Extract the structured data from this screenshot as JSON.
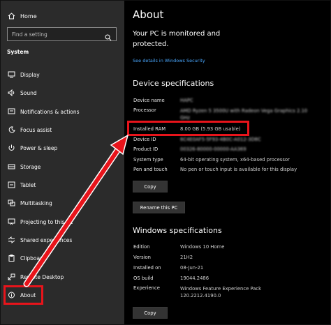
{
  "sidebar": {
    "home_label": "Home",
    "search_placeholder": "Find a setting",
    "section_label": "System",
    "items": [
      {
        "label": "Display",
        "icon": "display-icon"
      },
      {
        "label": "Sound",
        "icon": "sound-icon"
      },
      {
        "label": "Notifications & actions",
        "icon": "notifications-icon"
      },
      {
        "label": "Focus assist",
        "icon": "focus-assist-icon"
      },
      {
        "label": "Power & sleep",
        "icon": "power-icon"
      },
      {
        "label": "Storage",
        "icon": "storage-icon"
      },
      {
        "label": "Tablet",
        "icon": "tablet-icon"
      },
      {
        "label": "Multitasking",
        "icon": "multitasking-icon"
      },
      {
        "label": "Projecting to this PC",
        "icon": "projecting-icon"
      },
      {
        "label": "Shared experiences",
        "icon": "shared-experiences-icon"
      },
      {
        "label": "Clipboard",
        "icon": "clipboard-icon"
      },
      {
        "label": "Remote Desktop",
        "icon": "remote-desktop-icon"
      },
      {
        "label": "About",
        "icon": "info-icon"
      }
    ]
  },
  "main": {
    "title": "About",
    "monitored_text": "Your PC is monitored and protected.",
    "security_link": "See details in Windows Security",
    "device_specs_heading": "Device specifications",
    "device_specs": [
      {
        "key": "Device name",
        "value": "HAPC"
      },
      {
        "key": "Processor",
        "value": "AMD Ryzen 5 3500U with Radeon Vega Graphics 2.10 GHz"
      },
      {
        "key": "Installed RAM",
        "value": "8.00 GB (5.93 GB usable)"
      },
      {
        "key": "Device ID",
        "value": "6C4E0AF5-5F93-4B0C-A012-3D8C"
      },
      {
        "key": "Product ID",
        "value": "00326-80000-00000-AA369"
      },
      {
        "key": "System type",
        "value": "64-bit operating system, x64-based processor"
      },
      {
        "key": "Pen and touch",
        "value": "No pen or touch input is available for this display"
      }
    ],
    "copy_label": "Copy",
    "rename_label": "Rename this PC",
    "windows_specs_heading": "Windows specifications",
    "windows_specs": [
      {
        "key": "Edition",
        "value": "Windows 10 Home"
      },
      {
        "key": "Version",
        "value": "21H2"
      },
      {
        "key": "Installed on",
        "value": "08-Jun-21"
      },
      {
        "key": "OS build",
        "value": "19044.2486"
      },
      {
        "key": "Experience",
        "value": "Windows Feature Experience Pack",
        "value2": "120.2212.4190.0"
      }
    ],
    "copy2_label": "Copy"
  },
  "colors": {
    "annotation_red": "#e8141b",
    "link_blue": "#4aa8ff",
    "sidebar_bg": "#2b2b2b",
    "main_bg": "#000000"
  }
}
